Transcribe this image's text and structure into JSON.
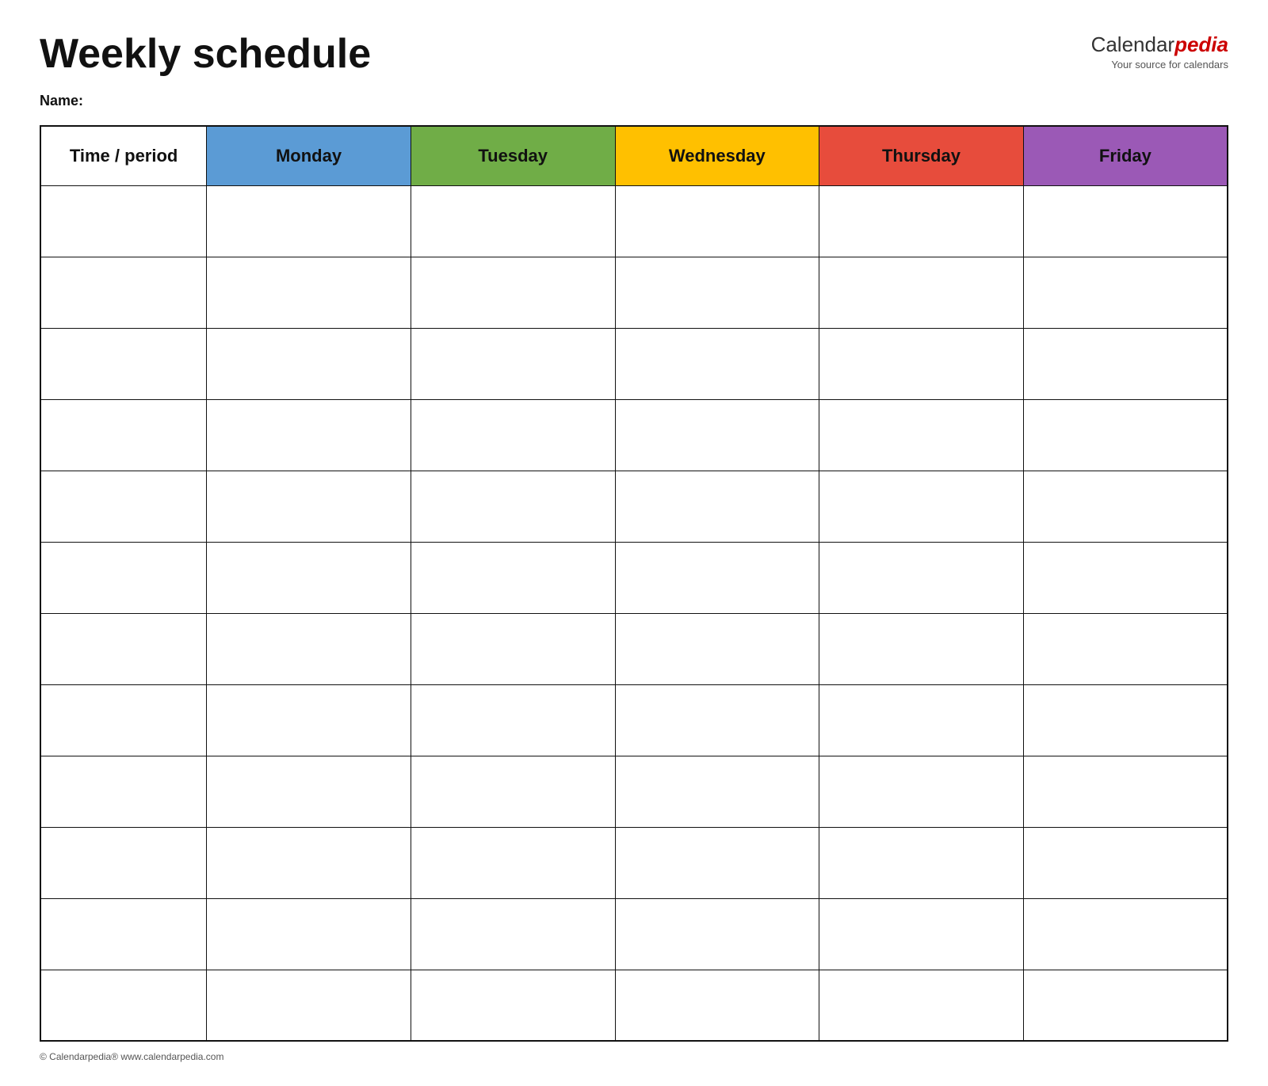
{
  "header": {
    "title": "Weekly schedule",
    "brand": {
      "calendar_text": "Calendar",
      "pedia_text": "pedia",
      "tagline": "Your source for calendars"
    },
    "name_label": "Name:"
  },
  "table": {
    "columns": [
      {
        "id": "time",
        "label": "Time / period",
        "color": "#ffffff"
      },
      {
        "id": "monday",
        "label": "Monday",
        "color": "#5b9bd5"
      },
      {
        "id": "tuesday",
        "label": "Tuesday",
        "color": "#70ad47"
      },
      {
        "id": "wednesday",
        "label": "Wednesday",
        "color": "#ffc000"
      },
      {
        "id": "thursday",
        "label": "Thursday",
        "color": "#e74c3c"
      },
      {
        "id": "friday",
        "label": "Friday",
        "color": "#9b59b6"
      }
    ],
    "row_count": 12
  },
  "footer": {
    "copyright": "© Calendarpedia®  www.calendarpedia.com"
  }
}
